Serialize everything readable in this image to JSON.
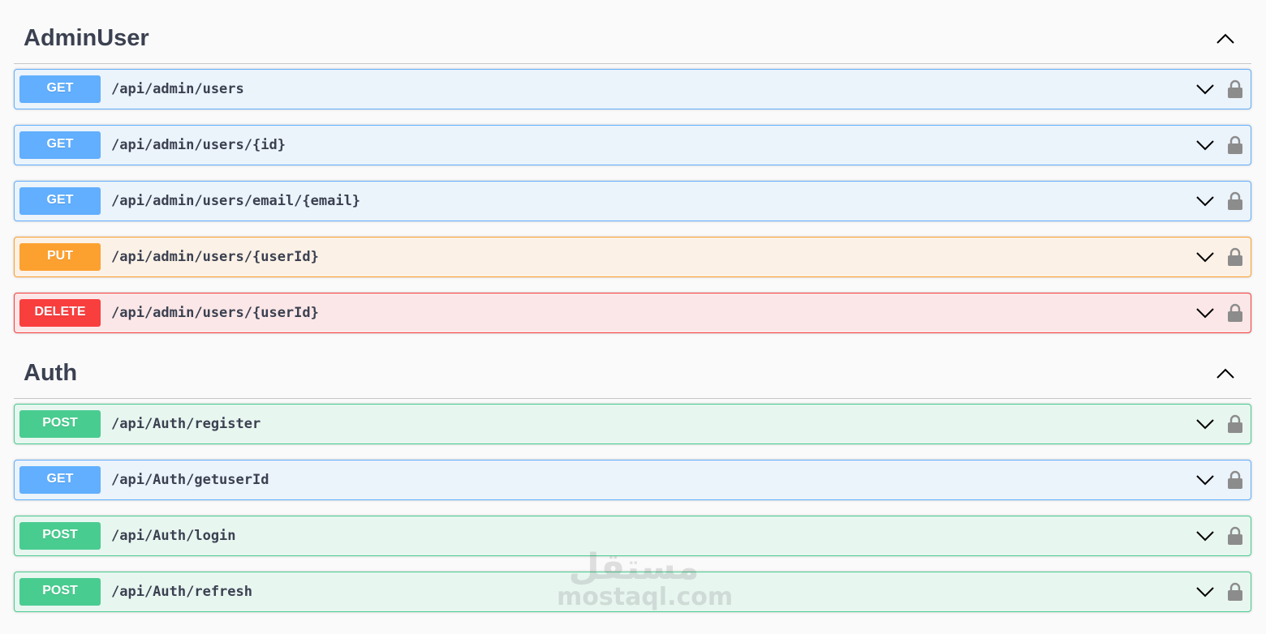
{
  "sections": [
    {
      "title": "AdminUser",
      "ops": [
        {
          "method": "GET",
          "kind": "get",
          "path": "/api/admin/users"
        },
        {
          "method": "GET",
          "kind": "get",
          "path": "/api/admin/users/{id}"
        },
        {
          "method": "GET",
          "kind": "get",
          "path": "/api/admin/users/email/{email}"
        },
        {
          "method": "PUT",
          "kind": "put",
          "path": "/api/admin/users/{userId}"
        },
        {
          "method": "DELETE",
          "kind": "delete",
          "path": "/api/admin/users/{userId}"
        }
      ]
    },
    {
      "title": "Auth",
      "ops": [
        {
          "method": "POST",
          "kind": "post",
          "path": "/api/Auth/register"
        },
        {
          "method": "GET",
          "kind": "get",
          "path": "/api/Auth/getuserId"
        },
        {
          "method": "POST",
          "kind": "post",
          "path": "/api/Auth/login"
        },
        {
          "method": "POST",
          "kind": "post",
          "path": "/api/Auth/refresh"
        }
      ]
    }
  ],
  "icons": {
    "section_toggle": "chevron-up-icon",
    "op_toggle": "chevron-down-icon",
    "auth": "lock-icon"
  },
  "colors": {
    "get": "#61affe",
    "put": "#fca130",
    "delete": "#f93e3e",
    "post": "#49cc90"
  },
  "watermark": {
    "arabic": "مستقل",
    "latin": "mostaql.com"
  }
}
